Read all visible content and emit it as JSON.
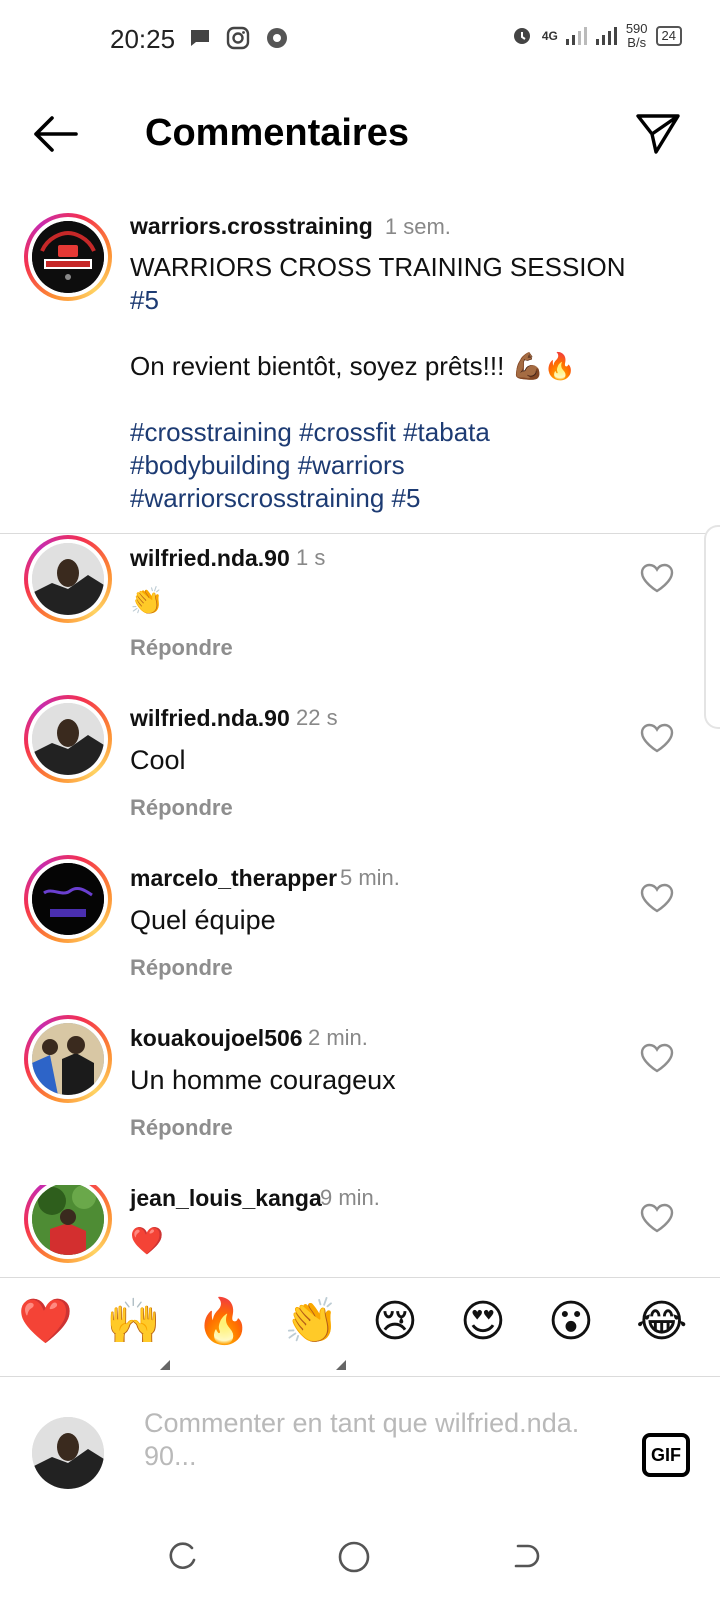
{
  "status_bar": {
    "time": "20:25",
    "network": "4G",
    "speed_value": "590",
    "speed_unit": "B/s",
    "battery": "24"
  },
  "header": {
    "title": "Commentaires"
  },
  "caption": {
    "username": "warriors.crosstraining",
    "time": "1 sem.",
    "line1": "WARRIORS CROSS TRAINING SESSION",
    "line1_tag": "#5",
    "line2": "On revient bientôt, soyez prêts!!! 💪🏾🔥",
    "hashtags1": "#crosstraining #crossfit #tabata",
    "hashtags2": "#bodybuilding #warriors",
    "hashtags3": "#warriorscrosstraining #5"
  },
  "comments": [
    {
      "username": "wilfried.nda.90",
      "time": "1 s",
      "text": "👏",
      "reply": "Répondre"
    },
    {
      "username": "wilfried.nda.90",
      "time": "22 s",
      "text": "Cool",
      "reply": "Répondre"
    },
    {
      "username": "marcelo_therapper",
      "time": "5 min.",
      "text": "Quel équipe",
      "reply": "Répondre"
    },
    {
      "username": "kouakoujoel506",
      "time": "2 min.",
      "text": "Un homme courageux",
      "reply": "Répondre"
    },
    {
      "username": "jean_louis_kanga",
      "time": "9 min.",
      "text": "❤️",
      "reply": ""
    }
  ],
  "emoji_bar": [
    "❤️",
    "🙌",
    "🔥",
    "👏",
    "😢",
    "😍",
    "😮",
    "😂"
  ],
  "composer": {
    "placeholder": "Commenter en tant que wilfried.nda. 90...",
    "gif_label": "GIF"
  },
  "colors": {
    "hashtag": "#1d3b73",
    "muted": "#8e8e8e",
    "ring_start": "#fd8d32",
    "ring_end": "#c82bae"
  }
}
